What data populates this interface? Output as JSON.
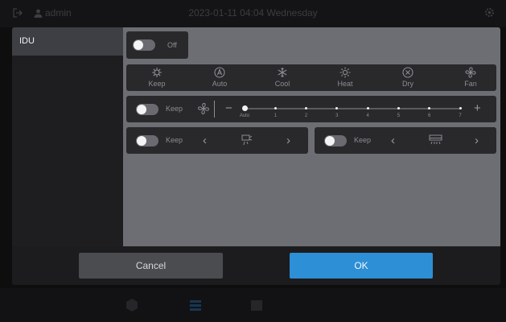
{
  "statusbar": {
    "user": "admin",
    "datetime": "2023-01-11 04:04 Wednesday"
  },
  "sidebar": {
    "items": [
      {
        "label": "IDU",
        "selected": true
      }
    ]
  },
  "power": {
    "state": "Off",
    "on": false
  },
  "modes": [
    {
      "label": "Keep",
      "icon": "keep-mode-icon"
    },
    {
      "label": "Auto",
      "icon": "auto-mode-icon"
    },
    {
      "label": "Cool",
      "icon": "snowflake-icon"
    },
    {
      "label": "Heat",
      "icon": "sun-icon"
    },
    {
      "label": "Dry",
      "icon": "droplet-icon"
    },
    {
      "label": "Fan",
      "icon": "fan-icon"
    }
  ],
  "fan_speed": {
    "toggle_label": "Keep",
    "minus": "−",
    "plus": "+",
    "selected": "Auto",
    "ticks": [
      "Auto",
      "1",
      "2",
      "3",
      "4",
      "5",
      "6",
      "7"
    ]
  },
  "swing_vertical": {
    "toggle_label": "Keep",
    "prev": "‹",
    "next": "›"
  },
  "swing_horizontal": {
    "toggle_label": "Keep",
    "prev": "‹",
    "next": "›"
  },
  "footer": {
    "cancel_label": "Cancel",
    "ok_label": "OK"
  },
  "colors": {
    "accent": "#2d8fd5",
    "dialog_bg": "#252528",
    "content_bg": "#6d6e73",
    "panel_bg": "#29292c"
  }
}
